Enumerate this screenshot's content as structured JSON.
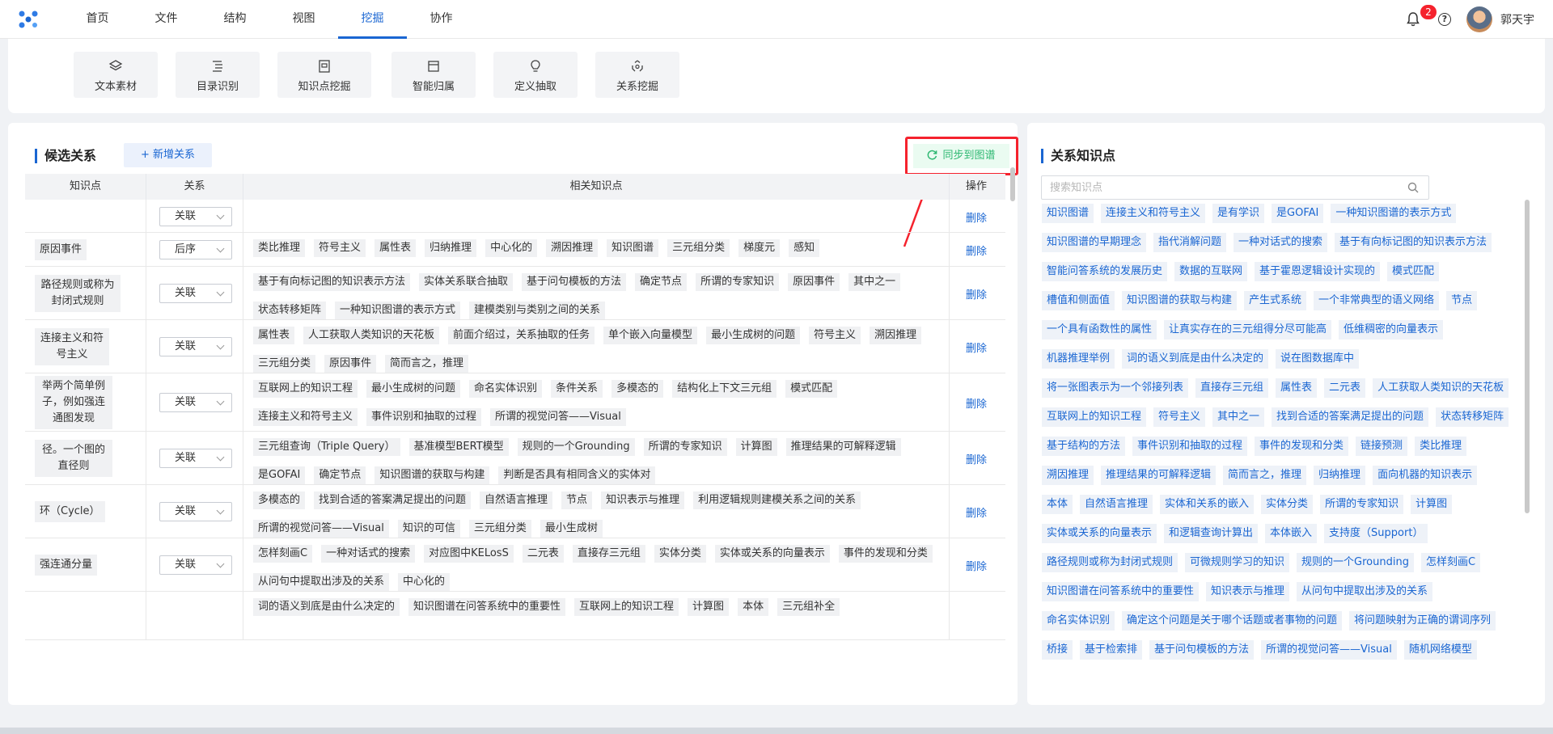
{
  "nav": {
    "items": [
      "首页",
      "文件",
      "结构",
      "视图",
      "挖掘",
      "协作"
    ],
    "active_index": 4
  },
  "header": {
    "notification_count": "2",
    "help_glyph": "?",
    "username": "郭天宇"
  },
  "tools": [
    {
      "label": "文本素材",
      "icon": "layers-icon"
    },
    {
      "label": "目录识别",
      "icon": "list-icon"
    },
    {
      "label": "知识点挖掘",
      "icon": "document-icon"
    },
    {
      "label": "智能归属",
      "icon": "folder-icon"
    },
    {
      "label": "定义抽取",
      "icon": "bulb-icon"
    },
    {
      "label": "关系挖掘",
      "icon": "relation-icon"
    }
  ],
  "candidate": {
    "title": "候选关系",
    "add_button": "+ 新增关系",
    "sync_button": "同步到图谱",
    "columns": [
      "知识点",
      "关系",
      "相关知识点",
      "操作"
    ],
    "rows": [
      {
        "kp": "",
        "rel": "关联",
        "tags": [],
        "op": "删除"
      },
      {
        "kp": "原因事件",
        "rel": "后序",
        "tags": [
          "类比推理",
          "符号主义",
          "属性表",
          "归纳推理",
          "中心化的",
          "溯因推理",
          "知识图谱",
          "三元组分类",
          "梯度元",
          "感知"
        ],
        "op": "删除"
      },
      {
        "kp": "路径规则或称为封闭式规则",
        "rel": "关联",
        "tags": [
          "基于有向标记图的知识表示方法",
          "实体关系联合抽取",
          "基于问句模板的方法",
          "确定节点",
          "所谓的专家知识",
          "原因事件",
          "其中之一",
          "状态转移矩阵",
          "一种知识图谱的表示方式",
          "建模类别与类别之间的关系"
        ],
        "op": "删除"
      },
      {
        "kp": "连接主义和符号主义",
        "rel": "关联",
        "tags": [
          "属性表",
          "人工获取人类知识的天花板",
          "前面介绍过，关系抽取的任务",
          "单个嵌入向量模型",
          "最小生成树的问题",
          "符号主义",
          "溯因推理",
          "三元组分类",
          "原因事件",
          "简而言之，推理"
        ],
        "op": "删除"
      },
      {
        "kp": "举两个简单例子，例如强连通图发现",
        "rel": "关联",
        "tags": [
          "互联网上的知识工程",
          "最小生成树的问题",
          "命名实体识别",
          "条件关系",
          "多模态的",
          "结构化上下文三元组",
          "模式匹配",
          "连接主义和符号主义",
          "事件识别和抽取的过程",
          "所谓的视觉问答——Visual"
        ],
        "op": "删除"
      },
      {
        "kp": "径。一个图的直径则",
        "rel": "关联",
        "tags": [
          "三元组查询（Triple Query）",
          "基准模型BERT模型",
          "规则的一个Grounding",
          "所谓的专家知识",
          "计算图",
          "推理结果的可解释逻辑",
          "是GOFAI",
          "确定节点",
          "知识图谱的获取与构建",
          "判断是否具有相同含义的实体对"
        ],
        "op": "删除"
      },
      {
        "kp": "环（Cycle）",
        "rel": "关联",
        "tags": [
          "多模态的",
          "找到合适的答案满足提出的问题",
          "自然语言推理",
          "节点",
          "知识表示与推理",
          "利用逻辑规则建模关系之间的关系",
          "所谓的视觉问答——Visual",
          "知识的可信",
          "三元组分类",
          "最小生成树"
        ],
        "op": "删除"
      },
      {
        "kp": "强连通分量",
        "rel": "关联",
        "tags": [
          "怎样刻画C",
          "一种对话式的搜索",
          "对应图中KELosS",
          "二元表",
          "直接存三元组",
          "实体分类",
          "实体或关系的向量表示",
          "事件的发现和分类",
          "从问句中提取出涉及的关系",
          "中心化的"
        ],
        "op": "删除"
      },
      {
        "kp": "",
        "rel": "",
        "tags": [
          "词的语义到底是由什么决定的",
          "知识图谱在问答系统中的重要性",
          "互联网上的知识工程",
          "计算图",
          "本体",
          "三元组补全"
        ],
        "op": ""
      }
    ]
  },
  "right": {
    "title": "关系知识点",
    "search_placeholder": "搜索知识点",
    "tags": [
      "知识图谱",
      "连接主义和符号主义",
      "是有学识",
      "是GOFAI",
      "一种知识图谱的表示方式",
      "知识图谱的早期理念",
      "指代消解问题",
      "一种对话式的搜索",
      "基于有向标记图的知识表示方法",
      "智能问答系统的发展历史",
      "数据的互联网",
      "基于霍恩逻辑设计实现的",
      "模式匹配",
      "槽值和侧面值",
      "知识图谱的获取与构建",
      "产生式系统",
      "一个非常典型的语义网络",
      "节点",
      "一个具有函数性的属性",
      "让真实存在的三元组得分尽可能高",
      "低维稠密的向量表示",
      "机器推理举例",
      "词的语义到底是由什么决定的",
      "说在图数据库中",
      "将一张图表示为一个邻接列表",
      "直接存三元组",
      "属性表",
      "二元表",
      "人工获取人类知识的天花板",
      "互联网上的知识工程",
      "符号主义",
      "其中之一",
      "找到合适的答案满足提出的问题",
      "状态转移矩阵",
      "基于结构的方法",
      "事件识别和抽取的过程",
      "事件的发现和分类",
      "链接预测",
      "类比推理",
      "溯因推理",
      "推理结果的可解释逻辑",
      "简而言之，推理",
      "归纳推理",
      "面向机器的知识表示",
      "本体",
      "自然语言推理",
      "实体和关系的嵌入",
      "实体分类",
      "所谓的专家知识",
      "计算图",
      "实体或关系的向量表示",
      "和逻辑查询计算出",
      "本体嵌入",
      "支持度（Support）",
      "路径规则或称为封闭式规则",
      "可微规则学习的知识",
      "规则的一个Grounding",
      "怎样刻画C",
      "知识图谱在问答系统中的重要性",
      "知识表示与推理",
      "从问句中提取出涉及的关系",
      "命名实体识别",
      "确定这个问题是关于哪个话题或者事物的问题",
      "将问题映射为正确的谓词序列",
      "桥接",
      "基于检索排",
      "基于问句模板的方法",
      "所谓的视觉问答——Visual",
      "随机网络模型"
    ]
  },
  "colors": {
    "accent": "#1a66d2",
    "sync_green": "#2eb872",
    "highlight_red": "#f5222d"
  }
}
